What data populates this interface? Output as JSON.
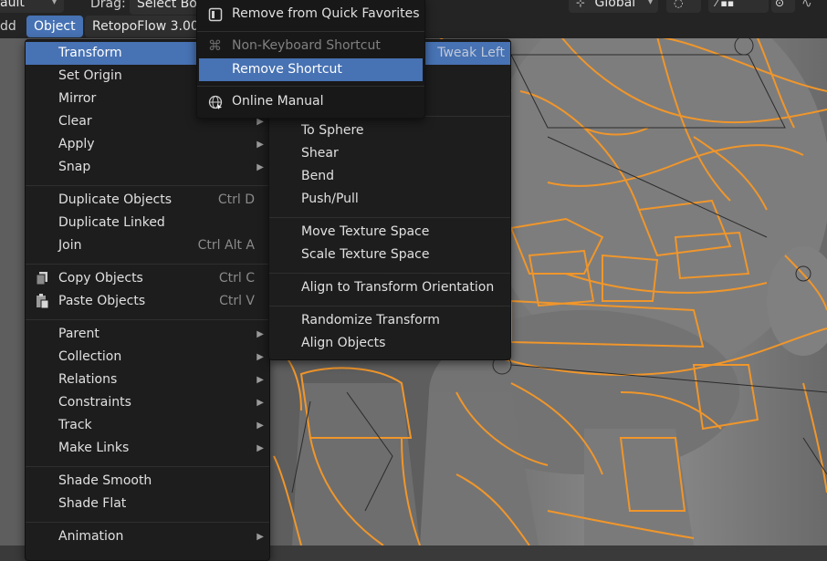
{
  "header": {
    "workspace_fragment": "ault",
    "add_fragment": "dd",
    "object_menu": "Object",
    "retopoflow_label": "RetopoFlow 3.00.",
    "drag_label": "Drag:",
    "drag_value": "Select Bo",
    "orientation_value": "Global"
  },
  "object_menu": {
    "items": [
      {
        "label": "Transform",
        "submenu": true,
        "active": true
      },
      {
        "label": "Set Origin",
        "submenu": true
      },
      {
        "label": "Mirror",
        "submenu": true
      },
      {
        "label": "Clear",
        "submenu": true
      },
      {
        "label": "Apply",
        "submenu": true
      },
      {
        "label": "Snap",
        "submenu": true
      },
      {
        "label": "Duplicate Objects",
        "shortcut": "Ctrl D"
      },
      {
        "label": "Duplicate Linked"
      },
      {
        "label": "Join",
        "shortcut": "Ctrl Alt A"
      },
      {
        "label": "Copy Objects",
        "shortcut": "Ctrl C",
        "icon": "copy-icon"
      },
      {
        "label": "Paste Objects",
        "shortcut": "Ctrl V",
        "icon": "paste-icon"
      },
      {
        "label": "Parent",
        "submenu": true
      },
      {
        "label": "Collection",
        "submenu": true
      },
      {
        "label": "Relations",
        "submenu": true
      },
      {
        "label": "Constraints",
        "submenu": true
      },
      {
        "label": "Track",
        "submenu": true
      },
      {
        "label": "Make Links",
        "submenu": true
      },
      {
        "label": "Shade Smooth"
      },
      {
        "label": "Shade Flat"
      },
      {
        "label": "Animation",
        "submenu": true
      }
    ]
  },
  "transform_menu": {
    "top_shortcut": "Tweak Left",
    "partial_item": "le",
    "items": [
      {
        "label": "To Sphere"
      },
      {
        "label": "Shear"
      },
      {
        "label": "Bend"
      },
      {
        "label": "Push/Pull"
      },
      {
        "label": "Move Texture Space"
      },
      {
        "label": "Scale Texture Space"
      },
      {
        "label": "Align to Transform Orientation"
      },
      {
        "label": "Randomize Transform"
      },
      {
        "label": "Align Objects"
      }
    ]
  },
  "context_menu": {
    "items": [
      {
        "label": "Remove from Quick Favorites",
        "icon": "quick-favorites-icon"
      },
      {
        "label": "Non-Keyboard Shortcut",
        "icon": "command-key-icon",
        "disabled": true
      },
      {
        "label": "Remove Shortcut",
        "active": true
      },
      {
        "label": "Online Manual",
        "icon": "globe-icon"
      }
    ]
  },
  "colors": {
    "accent": "#4772b3",
    "menu_bg": "#1d1d1d",
    "wire": "#f0962b",
    "header_bg": "#242424"
  }
}
